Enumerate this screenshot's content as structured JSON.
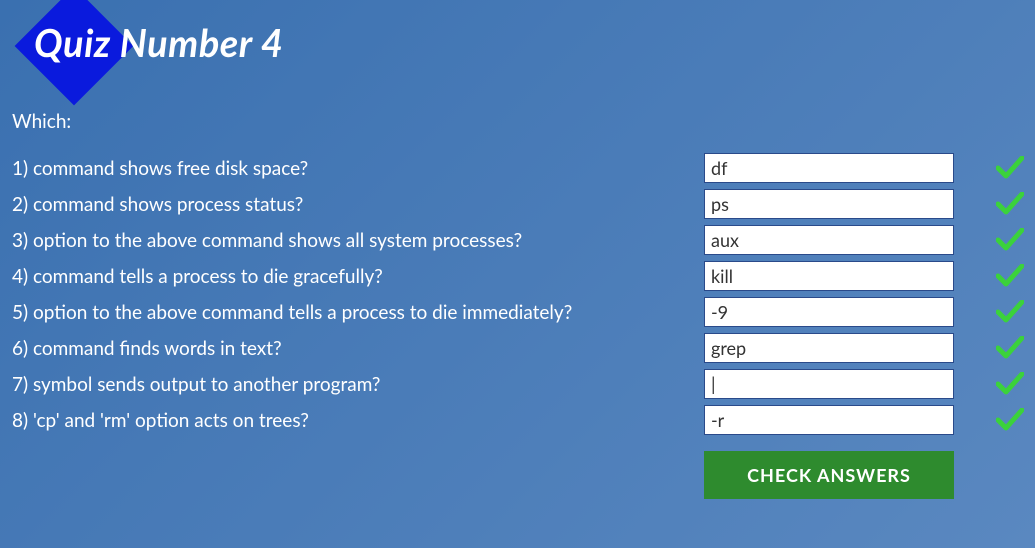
{
  "title": "Quiz Number 4",
  "prompt": "Which:",
  "questions": [
    {
      "label": "1) command shows free disk space?",
      "answer": "df",
      "correct": true
    },
    {
      "label": "2) command shows process status?",
      "answer": "ps",
      "correct": true
    },
    {
      "label": "3) option to the above command shows all system processes?",
      "answer": "aux",
      "correct": true
    },
    {
      "label": "4) command tells a process to die gracefully?",
      "answer": "kill",
      "correct": true
    },
    {
      "label": "5) option to the above command tells a process to die immediately?",
      "answer": "-9",
      "correct": true
    },
    {
      "label": "6) command finds words in text?",
      "answer": "grep",
      "correct": true
    },
    {
      "label": "7) symbol sends output to another program?",
      "answer": "|",
      "correct": true
    },
    {
      "label": "8) 'cp' and 'rm' option acts on trees?",
      "answer": "-r",
      "correct": true
    }
  ],
  "button": {
    "label": "CHECK ANSWERS"
  },
  "colors": {
    "diamond": "#0a1add",
    "button_bg": "#2e8b2e",
    "check_green": "#3bd23b"
  }
}
